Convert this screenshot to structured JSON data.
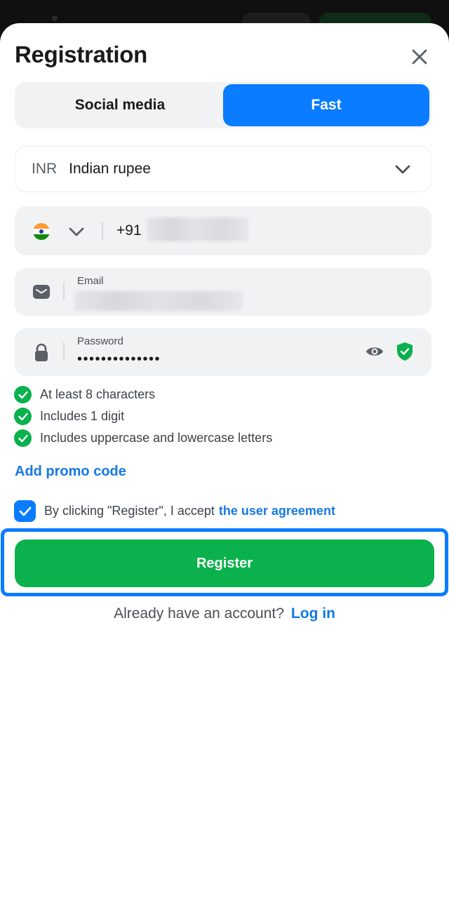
{
  "header": {
    "title": "Registration"
  },
  "tabs": [
    {
      "label": "Social media",
      "active": false
    },
    {
      "label": "Fast",
      "active": true
    }
  ],
  "currency": {
    "code": "INR",
    "name": "Indian rupee"
  },
  "phone": {
    "country_code": "+91",
    "flag_icon": "india-flag-icon"
  },
  "email": {
    "label": "Email"
  },
  "password": {
    "label": "Password",
    "masked_value": "••••••••••••••"
  },
  "password_rules": [
    {
      "text": "At least 8 characters",
      "met": true
    },
    {
      "text": "Includes 1 digit",
      "met": true
    },
    {
      "text": "Includes uppercase and lowercase letters",
      "met": true
    }
  ],
  "promo": {
    "label": "Add promo code"
  },
  "agreement": {
    "checked": true,
    "text": "By clicking \"Register\", I accept",
    "link": "the user agreement"
  },
  "register": {
    "label": "Register"
  },
  "login_prompt": {
    "text": "Already have an account?",
    "link": "Log in"
  },
  "colors": {
    "primary_blue": "#0a7cff",
    "link_blue": "#1579e6",
    "success_green": "#0ab14c",
    "field_bg": "#f1f2f4"
  }
}
